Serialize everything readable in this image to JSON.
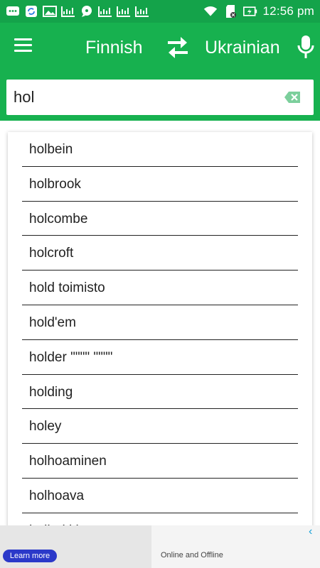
{
  "status_bar": {
    "time": "12:56 pm",
    "icons": [
      "message-icon",
      "sync-icon",
      "image-icon",
      "chart-icon",
      "chat-icon",
      "chart-icon",
      "chart-icon",
      "chart-icon",
      "wifi-icon",
      "sd-card-icon",
      "battery-charging-icon"
    ]
  },
  "app_bar": {
    "source_language": "Finnish",
    "target_language": "Ukrainian",
    "colors": {
      "status": "#14a34a",
      "toolbar": "#17b14f"
    }
  },
  "search": {
    "value": "hol",
    "placeholder": ""
  },
  "suggestions": [
    "holbein",
    "holbrook",
    "holcombe",
    "holcroft",
    "hold toimisto",
    "hold'em",
    "holder \"\"\"\" \"\"\"\"",
    "holding",
    "holey",
    "holhoaminen",
    "holhoava",
    "holhokki"
  ],
  "ad": {
    "button_label": "Learn more",
    "text": "Online and Offline"
  }
}
